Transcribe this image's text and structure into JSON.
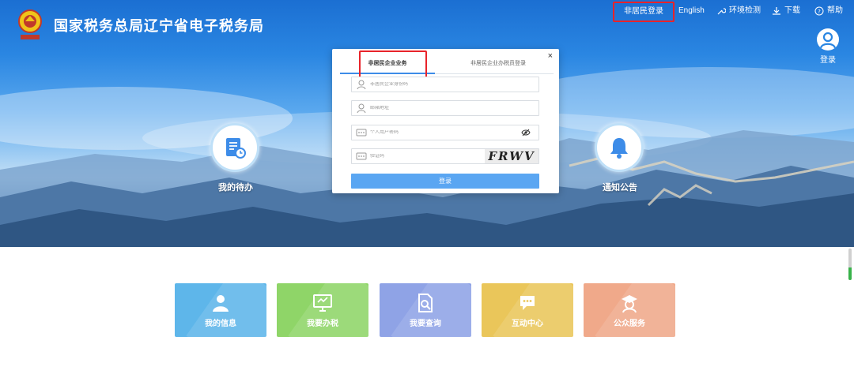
{
  "header": {
    "site_title": "国家税务总局辽宁省电子税务局",
    "nav": {
      "non_resident_login": "非居民登录",
      "english": "English",
      "env_check": "环境检测",
      "download": "下载",
      "help": "帮助"
    },
    "login_label": "登录"
  },
  "hero": {
    "todo_label": "我的待办",
    "notice_label": "通知公告"
  },
  "login_dialog": {
    "close": "×",
    "tabs": [
      {
        "label": "非居民企业业务",
        "active": true
      },
      {
        "label": "非居民企业办税员登录",
        "active": false
      }
    ],
    "fields": {
      "id_placeholder": "非居民企业身份码",
      "email_placeholder": "邮箱地址",
      "password_placeholder": "个人用户密码",
      "captcha_placeholder": "验证码"
    },
    "captcha_text": "FRWV",
    "submit": "登录"
  },
  "tiles": [
    {
      "label": "我的信息",
      "icon": "user-icon",
      "color": "#5eb6ea"
    },
    {
      "label": "我要办税",
      "icon": "monitor-icon",
      "color": "#8fd568"
    },
    {
      "label": "我要查询",
      "icon": "search-document-icon",
      "color": "#8fa3e6"
    },
    {
      "label": "互动中心",
      "icon": "chat-icon",
      "color": "#eac65a"
    },
    {
      "label": "公众服务",
      "icon": "service-icon",
      "color": "#f0a98a"
    }
  ],
  "colors": {
    "accent": "#3d8ce8",
    "button": "#5aa6f2",
    "highlight": "#e8232a"
  }
}
